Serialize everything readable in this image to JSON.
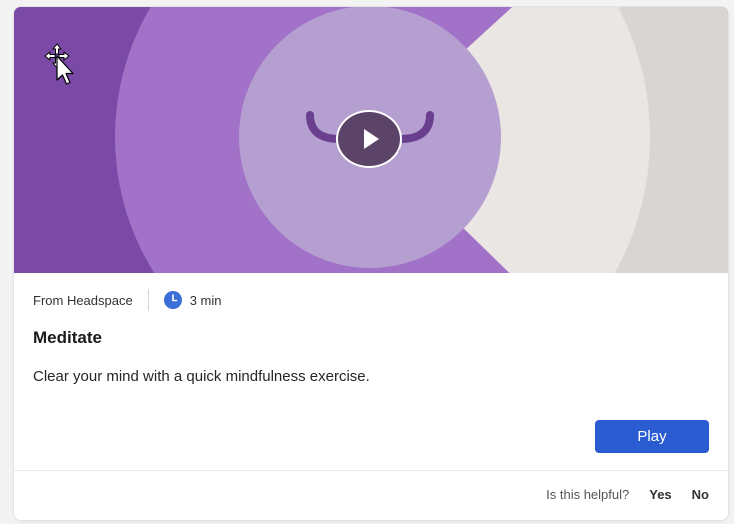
{
  "card": {
    "source": "From Headspace",
    "duration": "3 min",
    "title": "Meditate",
    "description": "Clear your mind with a quick mindfulness exercise.",
    "play_label": "Play"
  },
  "feedback": {
    "question": "Is this helpful?",
    "yes_label": "Yes",
    "no_label": "No"
  },
  "colors": {
    "accent": "#2b5bd1",
    "hero_purple": "#a272c8",
    "hero_lavender": "#b59fd1",
    "hero_cream": "#eae6e3"
  },
  "icons": {
    "clock": "clock-icon",
    "play": "play-icon",
    "cursor": "move-cursor-icon"
  }
}
